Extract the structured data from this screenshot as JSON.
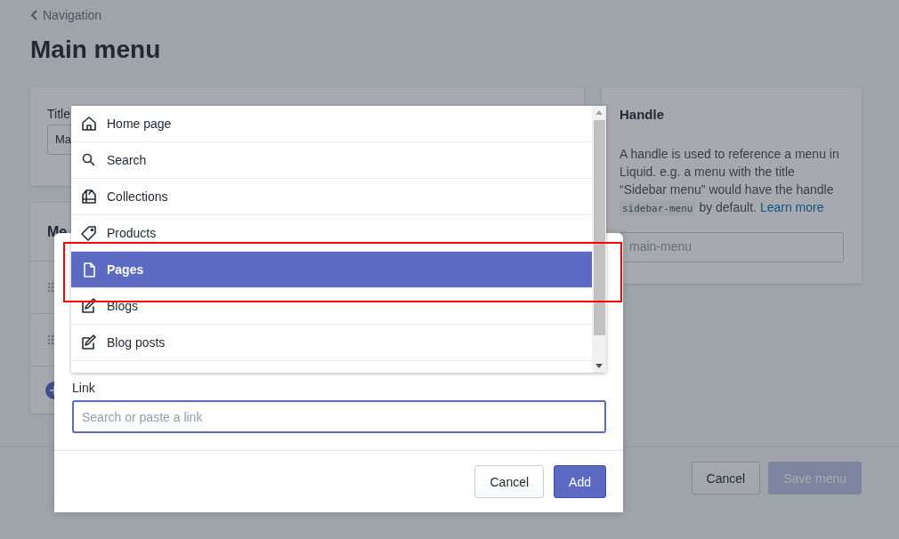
{
  "breadcrumb": {
    "label": "Navigation"
  },
  "page_title": "Main menu",
  "title_card": {
    "label": "Title",
    "value": "Ma"
  },
  "menu_items_card": {
    "heading": "Me"
  },
  "handle_card": {
    "heading": "Handle",
    "description": "A handle is used to reference a menu in Liquid. e.g. a menu with the title “Sidebar menu” would have the handle",
    "code": "sidebar-menu",
    "description_end": "by default.",
    "link": "Learn more",
    "value": "main-menu"
  },
  "footer": {
    "buttons": [
      {
        "label": "Cancel",
        "kind": "secondary",
        "disabled": false
      },
      {
        "label": "Save menu",
        "kind": "primary",
        "disabled": true
      }
    ]
  },
  "modal": {
    "link_label": "Link",
    "link_placeholder": "Search or paste a link",
    "buttons": [
      {
        "label": "Cancel",
        "kind": "secondary"
      },
      {
        "label": "Add",
        "kind": "primary"
      }
    ]
  },
  "dropdown": {
    "items": [
      {
        "label": "Home page",
        "selected": false
      },
      {
        "label": "Search",
        "selected": false
      },
      {
        "label": "Collections",
        "selected": false
      },
      {
        "label": "Products",
        "selected": false
      },
      {
        "label": "Pages",
        "selected": true
      },
      {
        "label": "Blogs",
        "selected": false
      },
      {
        "label": "Blog posts",
        "selected": false
      }
    ]
  }
}
